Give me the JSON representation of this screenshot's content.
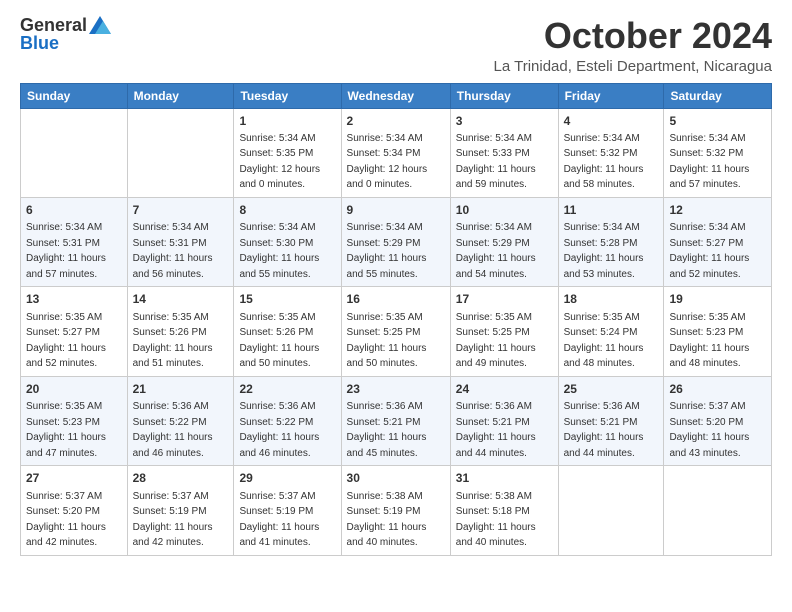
{
  "logo": {
    "general": "General",
    "blue": "Blue"
  },
  "title": {
    "month": "October 2024",
    "location": "La Trinidad, Esteli Department, Nicaragua"
  },
  "headers": [
    "Sunday",
    "Monday",
    "Tuesday",
    "Wednesday",
    "Thursday",
    "Friday",
    "Saturday"
  ],
  "weeks": [
    [
      {
        "day": "",
        "info": ""
      },
      {
        "day": "",
        "info": ""
      },
      {
        "day": "1",
        "info": "Sunrise: 5:34 AM\nSunset: 5:35 PM\nDaylight: 12 hours and 0 minutes."
      },
      {
        "day": "2",
        "info": "Sunrise: 5:34 AM\nSunset: 5:34 PM\nDaylight: 12 hours and 0 minutes."
      },
      {
        "day": "3",
        "info": "Sunrise: 5:34 AM\nSunset: 5:33 PM\nDaylight: 11 hours and 59 minutes."
      },
      {
        "day": "4",
        "info": "Sunrise: 5:34 AM\nSunset: 5:32 PM\nDaylight: 11 hours and 58 minutes."
      },
      {
        "day": "5",
        "info": "Sunrise: 5:34 AM\nSunset: 5:32 PM\nDaylight: 11 hours and 57 minutes."
      }
    ],
    [
      {
        "day": "6",
        "info": "Sunrise: 5:34 AM\nSunset: 5:31 PM\nDaylight: 11 hours and 57 minutes."
      },
      {
        "day": "7",
        "info": "Sunrise: 5:34 AM\nSunset: 5:31 PM\nDaylight: 11 hours and 56 minutes."
      },
      {
        "day": "8",
        "info": "Sunrise: 5:34 AM\nSunset: 5:30 PM\nDaylight: 11 hours and 55 minutes."
      },
      {
        "day": "9",
        "info": "Sunrise: 5:34 AM\nSunset: 5:29 PM\nDaylight: 11 hours and 55 minutes."
      },
      {
        "day": "10",
        "info": "Sunrise: 5:34 AM\nSunset: 5:29 PM\nDaylight: 11 hours and 54 minutes."
      },
      {
        "day": "11",
        "info": "Sunrise: 5:34 AM\nSunset: 5:28 PM\nDaylight: 11 hours and 53 minutes."
      },
      {
        "day": "12",
        "info": "Sunrise: 5:34 AM\nSunset: 5:27 PM\nDaylight: 11 hours and 52 minutes."
      }
    ],
    [
      {
        "day": "13",
        "info": "Sunrise: 5:35 AM\nSunset: 5:27 PM\nDaylight: 11 hours and 52 minutes."
      },
      {
        "day": "14",
        "info": "Sunrise: 5:35 AM\nSunset: 5:26 PM\nDaylight: 11 hours and 51 minutes."
      },
      {
        "day": "15",
        "info": "Sunrise: 5:35 AM\nSunset: 5:26 PM\nDaylight: 11 hours and 50 minutes."
      },
      {
        "day": "16",
        "info": "Sunrise: 5:35 AM\nSunset: 5:25 PM\nDaylight: 11 hours and 50 minutes."
      },
      {
        "day": "17",
        "info": "Sunrise: 5:35 AM\nSunset: 5:25 PM\nDaylight: 11 hours and 49 minutes."
      },
      {
        "day": "18",
        "info": "Sunrise: 5:35 AM\nSunset: 5:24 PM\nDaylight: 11 hours and 48 minutes."
      },
      {
        "day": "19",
        "info": "Sunrise: 5:35 AM\nSunset: 5:23 PM\nDaylight: 11 hours and 48 minutes."
      }
    ],
    [
      {
        "day": "20",
        "info": "Sunrise: 5:35 AM\nSunset: 5:23 PM\nDaylight: 11 hours and 47 minutes."
      },
      {
        "day": "21",
        "info": "Sunrise: 5:36 AM\nSunset: 5:22 PM\nDaylight: 11 hours and 46 minutes."
      },
      {
        "day": "22",
        "info": "Sunrise: 5:36 AM\nSunset: 5:22 PM\nDaylight: 11 hours and 46 minutes."
      },
      {
        "day": "23",
        "info": "Sunrise: 5:36 AM\nSunset: 5:21 PM\nDaylight: 11 hours and 45 minutes."
      },
      {
        "day": "24",
        "info": "Sunrise: 5:36 AM\nSunset: 5:21 PM\nDaylight: 11 hours and 44 minutes."
      },
      {
        "day": "25",
        "info": "Sunrise: 5:36 AM\nSunset: 5:21 PM\nDaylight: 11 hours and 44 minutes."
      },
      {
        "day": "26",
        "info": "Sunrise: 5:37 AM\nSunset: 5:20 PM\nDaylight: 11 hours and 43 minutes."
      }
    ],
    [
      {
        "day": "27",
        "info": "Sunrise: 5:37 AM\nSunset: 5:20 PM\nDaylight: 11 hours and 42 minutes."
      },
      {
        "day": "28",
        "info": "Sunrise: 5:37 AM\nSunset: 5:19 PM\nDaylight: 11 hours and 42 minutes."
      },
      {
        "day": "29",
        "info": "Sunrise: 5:37 AM\nSunset: 5:19 PM\nDaylight: 11 hours and 41 minutes."
      },
      {
        "day": "30",
        "info": "Sunrise: 5:38 AM\nSunset: 5:19 PM\nDaylight: 11 hours and 40 minutes."
      },
      {
        "day": "31",
        "info": "Sunrise: 5:38 AM\nSunset: 5:18 PM\nDaylight: 11 hours and 40 minutes."
      },
      {
        "day": "",
        "info": ""
      },
      {
        "day": "",
        "info": ""
      }
    ]
  ]
}
